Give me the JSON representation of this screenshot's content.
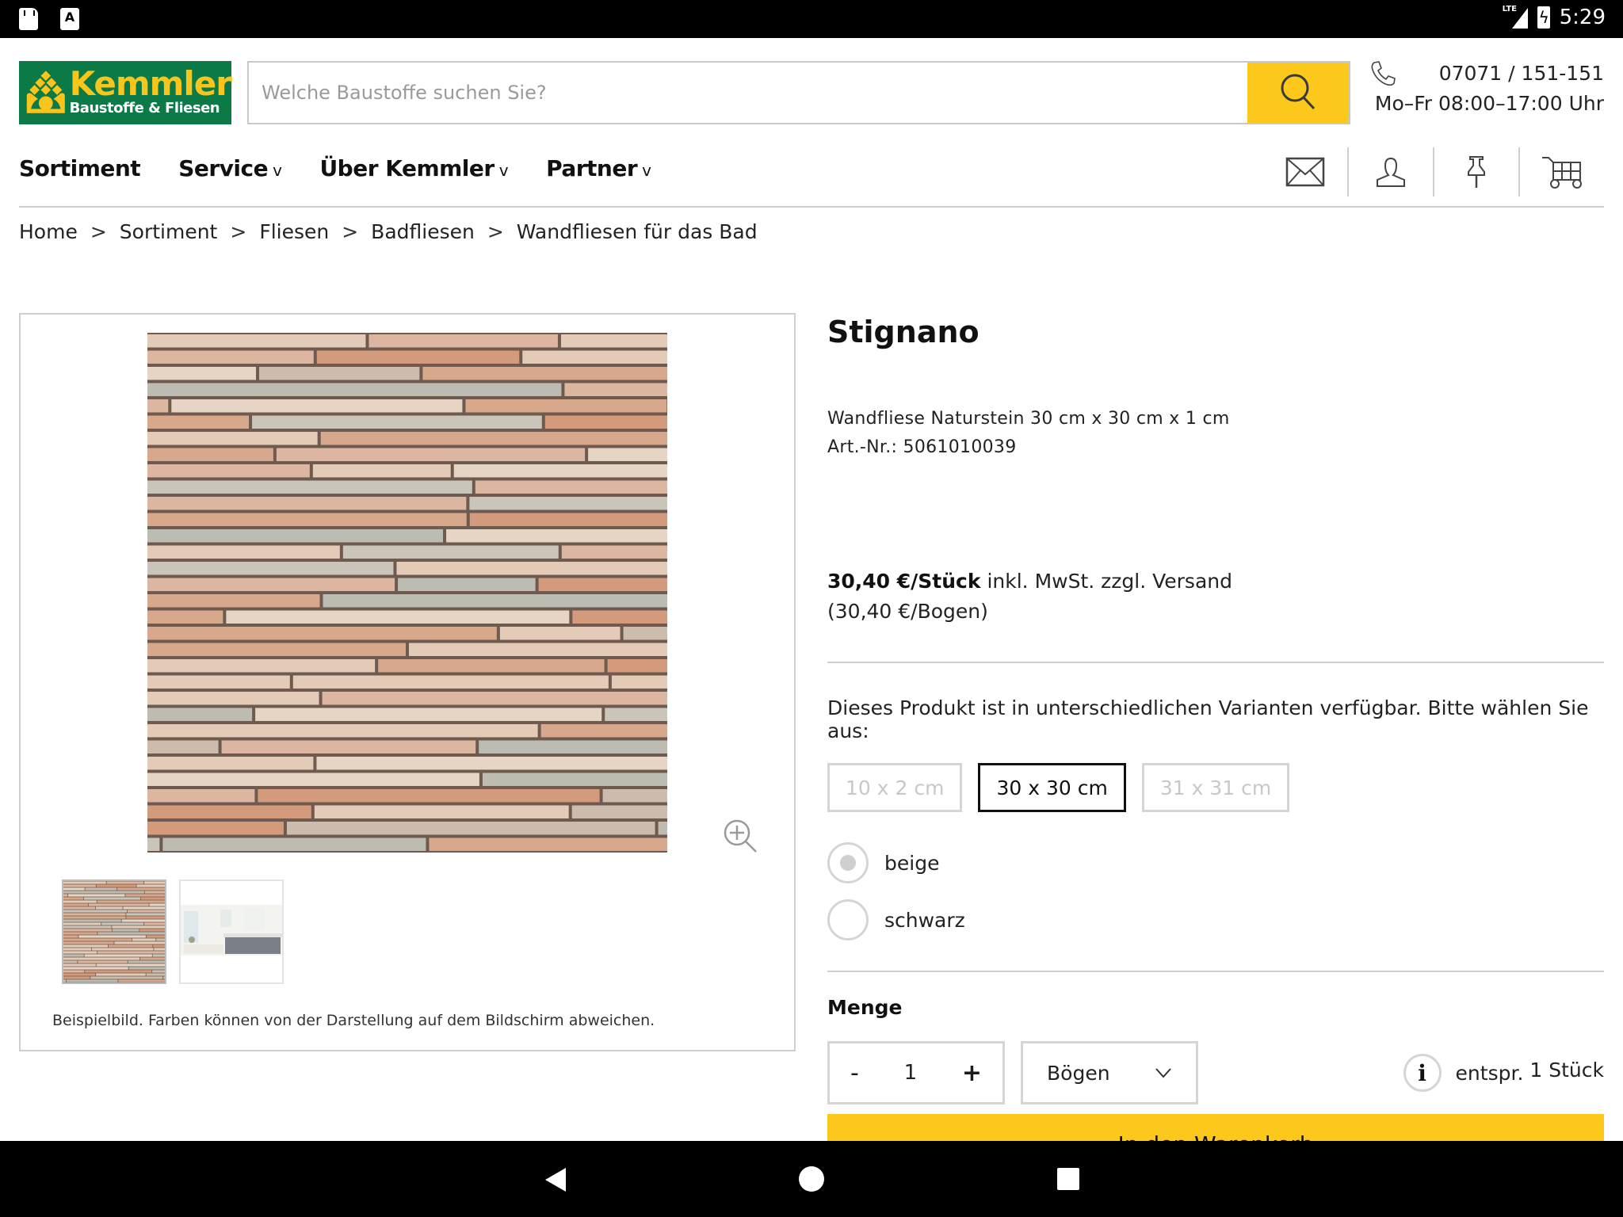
{
  "status_bar": {
    "time": "5:29",
    "network": "LTE",
    "left_icons": [
      "sd-card-icon",
      "a-notification-icon"
    ]
  },
  "header": {
    "logo": {
      "name": "Kemmler",
      "tagline": "Baustoffe & Fliesen"
    },
    "search": {
      "placeholder": "Welche Baustoffe suchen Sie?",
      "value": ""
    },
    "contact": {
      "phone": "07071 / 151-151",
      "hours": "Mo–Fr 08:00–17:00 Uhr"
    },
    "brand_colors": {
      "green": "#0b7a46",
      "yellow": "#fcc81c"
    }
  },
  "nav": {
    "items": [
      {
        "label": "Sortiment",
        "has_dropdown": false
      },
      {
        "label": "Service",
        "has_dropdown": true
      },
      {
        "label": "Über Kemmler",
        "has_dropdown": true
      },
      {
        "label": "Partner",
        "has_dropdown": true
      }
    ],
    "caret": "v",
    "icons": [
      "mail-icon",
      "user-icon",
      "pin-icon",
      "cart-icon"
    ]
  },
  "breadcrumb": {
    "separator": ">",
    "items": [
      "Home",
      "Sortiment",
      "Fliesen",
      "Badfliesen",
      "Wandfliesen für das Bad"
    ]
  },
  "gallery": {
    "disclaimer": "Beispielbild. Farben können von der Darstellung auf dem Bildschirm abweichen.",
    "thumbnails": [
      "tile-mosaic",
      "bathroom-scene"
    ],
    "active_thumbnail": 0
  },
  "product": {
    "title": "Stignano",
    "description": "Wandfliese Naturstein 30 cm x 30 cm x 1 cm",
    "article_no": "Art.-Nr.: 5061010039",
    "price_main": "30,40 €/Stück",
    "price_note": " inkl. MwSt. zzgl. Versand",
    "price_unit": "(30,40 €/Bogen)",
    "variant_prompt": "Dieses Produkt ist in unterschiedlichen Varianten verfügbar. Bitte wählen Sie aus:",
    "sizes": [
      {
        "label": "10 x 2 cm",
        "selected": false
      },
      {
        "label": "30 x 30 cm",
        "selected": true
      },
      {
        "label": "31 x 31 cm",
        "selected": false
      }
    ],
    "colors": [
      {
        "label": "beige",
        "checked": true
      },
      {
        "label": "schwarz",
        "checked": false
      }
    ],
    "quantity_label": "Menge",
    "quantity": {
      "minus": "-",
      "value": "1",
      "plus": "+"
    },
    "unit_select": "Bögen",
    "equivalent_prefix": "entspr.",
    "equivalent_value": "1 Stück",
    "cart_button": "In den Warenkorb"
  }
}
